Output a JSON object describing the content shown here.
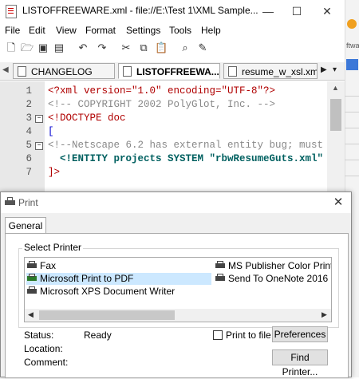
{
  "editor": {
    "window_title": "LISTOFFREEWARE.xml - file://E:\\Test 1\\XML Sample...",
    "menu": [
      "File",
      "Edit",
      "View",
      "Format",
      "Settings",
      "Tools",
      "Help"
    ],
    "tabs": [
      "CHANGELOG",
      "LISTOFFREEWA...",
      "resume_w_xsl.xml"
    ],
    "line_numbers": [
      "1",
      "2",
      "3",
      "4",
      "5",
      "6",
      "7"
    ],
    "code_lines": [
      "<?xml version=\"1.0\" encoding=\"UTF-8\"?>",
      "<!-- COPYRIGHT 2002 PolyGlot, Inc. -->",
      "<!DOCTYPE doc",
      "[",
      "<!--Netscape 6.2 has external entity bug; must",
      "  <!ENTITY projects SYSTEM \"rbwResumeGuts.xml\"",
      "]>"
    ],
    "right_partial": [
      "ftwa"
    ]
  },
  "dialog": {
    "title": "Print",
    "tab": "General",
    "group_label": "Select Printer",
    "printers_left": [
      "Fax",
      "Microsoft Print to PDF",
      "Microsoft XPS Document Writer"
    ],
    "printers_right": [
      "MS Publisher Color Print",
      "Send To OneNote 2016"
    ],
    "selected_printer": "Microsoft Print to PDF",
    "status_label": "Status:",
    "status_value": "Ready",
    "location_label": "Location:",
    "comment_label": "Comment:",
    "print_to_file_label": "Print to file",
    "preferences_button": "Preferences",
    "find_printer_button": "Find Printer..."
  }
}
